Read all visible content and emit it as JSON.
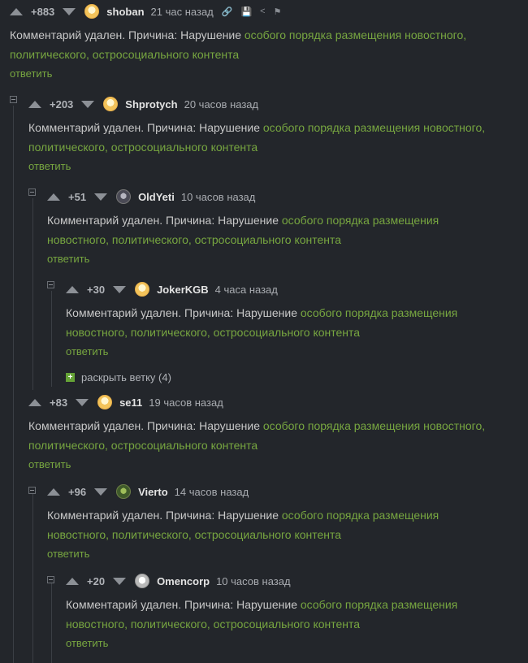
{
  "comments": [
    {
      "rating": "+883",
      "nick": "shoban",
      "time": "21 час назад",
      "reason_prefix": "Комментарий удален. Причина: Нарушение ",
      "reason_link": "особого порядка размещения новостного, политического, остросоциального контента",
      "reply": "ответить",
      "tools": {
        "link": "🔗",
        "save": "💾",
        "share": "<",
        "flag": "⚑"
      }
    },
    {
      "rating": "+203",
      "nick": "Shprotych",
      "time": "20 часов назад",
      "reason_prefix": "Комментарий удален. Причина: Нарушение ",
      "reason_link": "особого порядка размещения новостного, политического, остросоциального контента",
      "reply": "ответить"
    },
    {
      "rating": "+51",
      "nick": "OldYeti",
      "time": "10 часов назад",
      "reason_prefix": "Комментарий удален. Причина: Нарушение ",
      "reason_link": "особого порядка размещения новостного, политического, остросоциального контента",
      "reply": "ответить"
    },
    {
      "rating": "+30",
      "nick": "JokerKGB",
      "time": "4 часа назад",
      "reason_prefix": "Комментарий удален. Причина: Нарушение ",
      "reason_link": "особого порядка размещения новостного, политического, остросоциального контента",
      "reply": "ответить"
    },
    {
      "rating": "+83",
      "nick": "se11",
      "time": "19 часов назад",
      "reason_prefix": "Комментарий удален. Причина: Нарушение ",
      "reason_link": "особого порядка размещения новостного, политического, остросоциального контента",
      "reply": "ответить"
    },
    {
      "rating": "+96",
      "nick": "Vierto",
      "time": "14 часов назад",
      "reason_prefix": "Комментарий удален. Причина: Нарушение ",
      "reason_link": "особого порядка размещения новостного, политического, остросоциального контента",
      "reply": "ответить"
    },
    {
      "rating": "+20",
      "nick": "Omencorp",
      "time": "10 часов назад",
      "reason_prefix": "Комментарий удален. Причина: Нарушение ",
      "reason_link": "особого порядка размещения новостного, политического, остросоциального контента",
      "reply": "ответить"
    }
  ],
  "expand_branch": {
    "label": "раскрыть ветку (4)",
    "icon": "+"
  }
}
